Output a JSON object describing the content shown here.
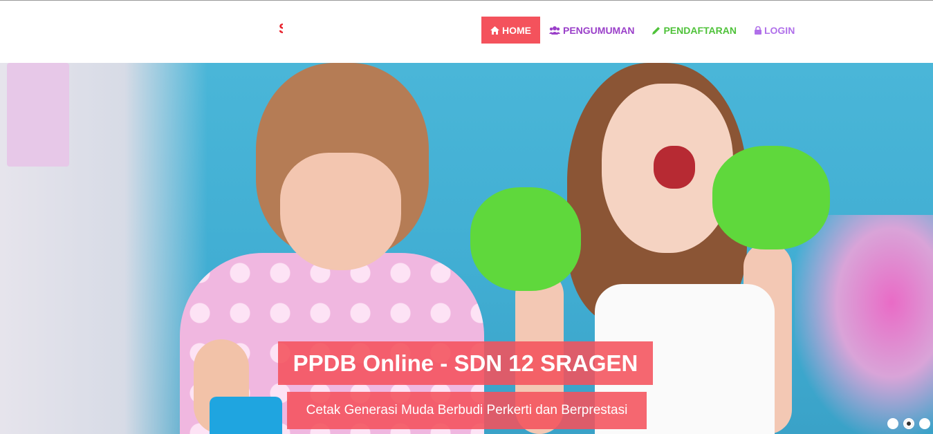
{
  "header": {
    "logo_text": "S",
    "nav": [
      {
        "label": "HOME",
        "icon": "home-icon",
        "active": true,
        "color": "#f4525c"
      },
      {
        "label": "PENGUMUMAN",
        "icon": "users-icon",
        "color": "#9a3fc9"
      },
      {
        "label": "PENDAFTARAN",
        "icon": "pencil-icon",
        "color": "#4fc23a"
      },
      {
        "label": "LOGIN",
        "icon": "lock-icon",
        "color": "#b070ea"
      }
    ]
  },
  "hero": {
    "title": "PPDB Online - SDN 12 SRAGEN",
    "subtitle": "Cetak Generasi Muda Berbudi Perkerti dan Berprestasi",
    "slides_count": 3,
    "active_slide": 2
  },
  "colors": {
    "accent": "#f4525c"
  }
}
